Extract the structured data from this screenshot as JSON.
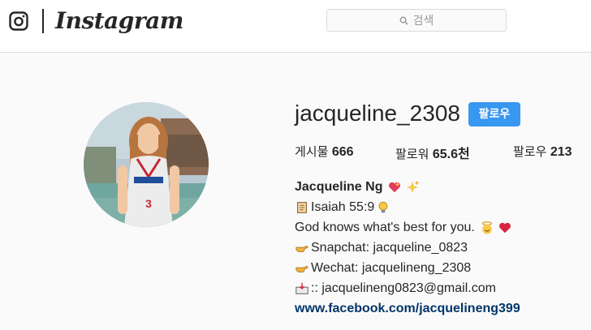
{
  "nav": {
    "brand": "Instagram",
    "search_placeholder": "검색"
  },
  "profile": {
    "username": "jacqueline_2308",
    "follow_label": "팔로우",
    "stats": {
      "posts_label": "게시물",
      "posts_value": "666",
      "followers_label": "팔로워",
      "followers_value": "65.6천",
      "following_label": "팔로우",
      "following_value": "213"
    },
    "bio": {
      "full_name": "Jacqueline Ng",
      "verse": "Isaiah 55:9",
      "quote": "God knows what's best for you.",
      "snapchat": "Snapchat: jacqueline_0823",
      "wechat": "Wechat: jacquelineng_2308",
      "email": ":: jacquelineng0823@gmail.com",
      "website": "www.facebook.com/jacquelineng399"
    }
  },
  "icons": {
    "camera": "instagram-camera-icon",
    "search": "search-icon",
    "emoji": [
      "sparkling-heart",
      "sparkles",
      "scroll",
      "light-bulb",
      "smiling-angel",
      "red-heart",
      "pointing-right",
      "inbox-tray"
    ]
  },
  "colors": {
    "accent": "#3897f0",
    "link": "#003569",
    "text": "#262626",
    "background": "#fafafa"
  }
}
